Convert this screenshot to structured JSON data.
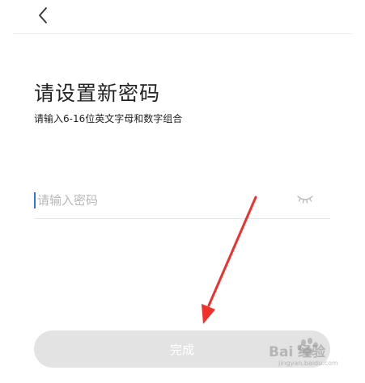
{
  "nav": {
    "back_icon": "chevron-left-icon"
  },
  "header": {
    "title": "请设置新密码",
    "subtitle": "请输入6-16位英文字母和数字组合"
  },
  "password_field": {
    "placeholder": "请输入密码",
    "value": "",
    "visibility_icon": "eye-closed-icon"
  },
  "actions": {
    "done_label": "完成"
  },
  "annotation": {
    "arrow_color": "#f0302d"
  },
  "watermark": {
    "brand": "Bai  经验",
    "url": "jingyan.baidu.com"
  },
  "colors": {
    "caret": "#2b6ff6",
    "button_disabled_bg": "#e3e3e3",
    "title_text": "#222222",
    "placeholder_text": "#b8b8b8"
  }
}
